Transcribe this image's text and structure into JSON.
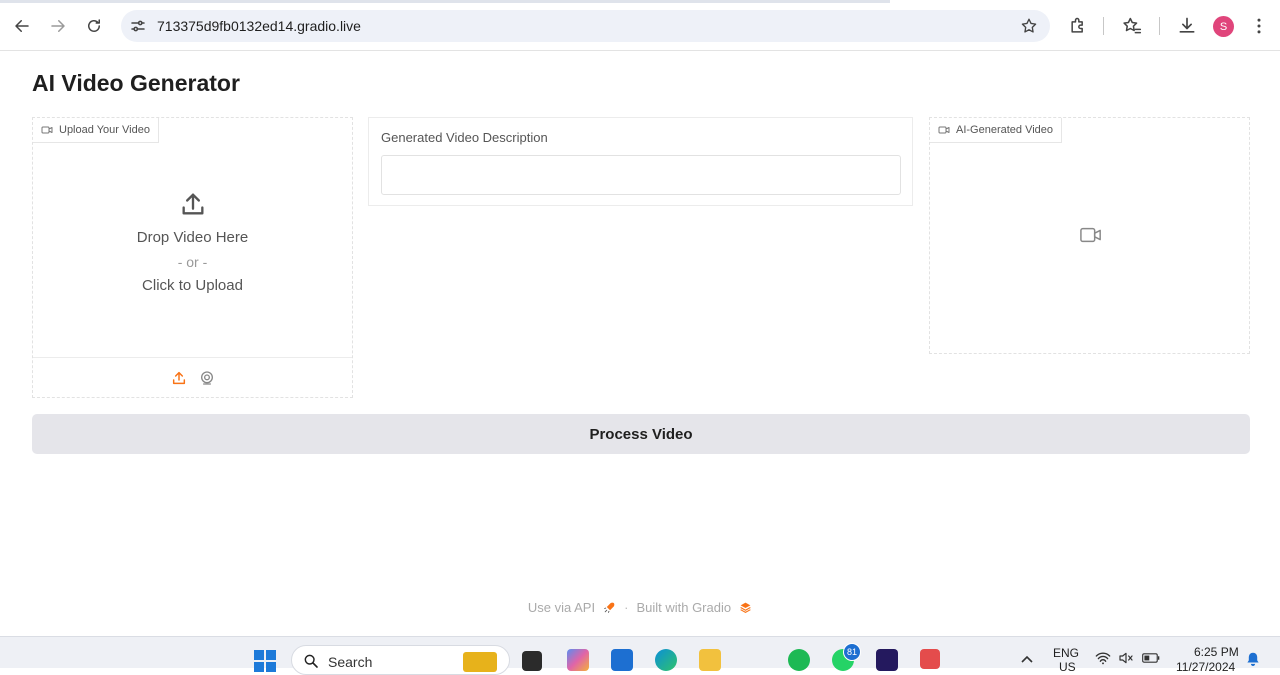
{
  "browser": {
    "url": "713375d9fb0132ed14.gradio.live",
    "profile_initial": "S"
  },
  "app": {
    "title": "AI Video Generator",
    "upload_panel": {
      "label": "Upload Your Video",
      "drop_text": "Drop Video Here",
      "or_text": "- or -",
      "click_text": "Click to Upload"
    },
    "description_panel": {
      "label": "Generated Video Description",
      "value": ""
    },
    "output_panel": {
      "label": "AI-Generated Video"
    },
    "process_button": "Process Video",
    "footer": {
      "api_link": "Use via API",
      "separator": "·",
      "built_with": "Built with Gradio"
    }
  },
  "taskbar": {
    "search_label": "Search",
    "whatsapp_badge": "81",
    "language": "ENG",
    "region": "US",
    "time": "6:25 PM",
    "date": "11/27/2024"
  },
  "colors": {
    "accent_orange": "#f97316",
    "button_bg": "#e5e5ea",
    "avatar_bg": "#e0457b"
  }
}
